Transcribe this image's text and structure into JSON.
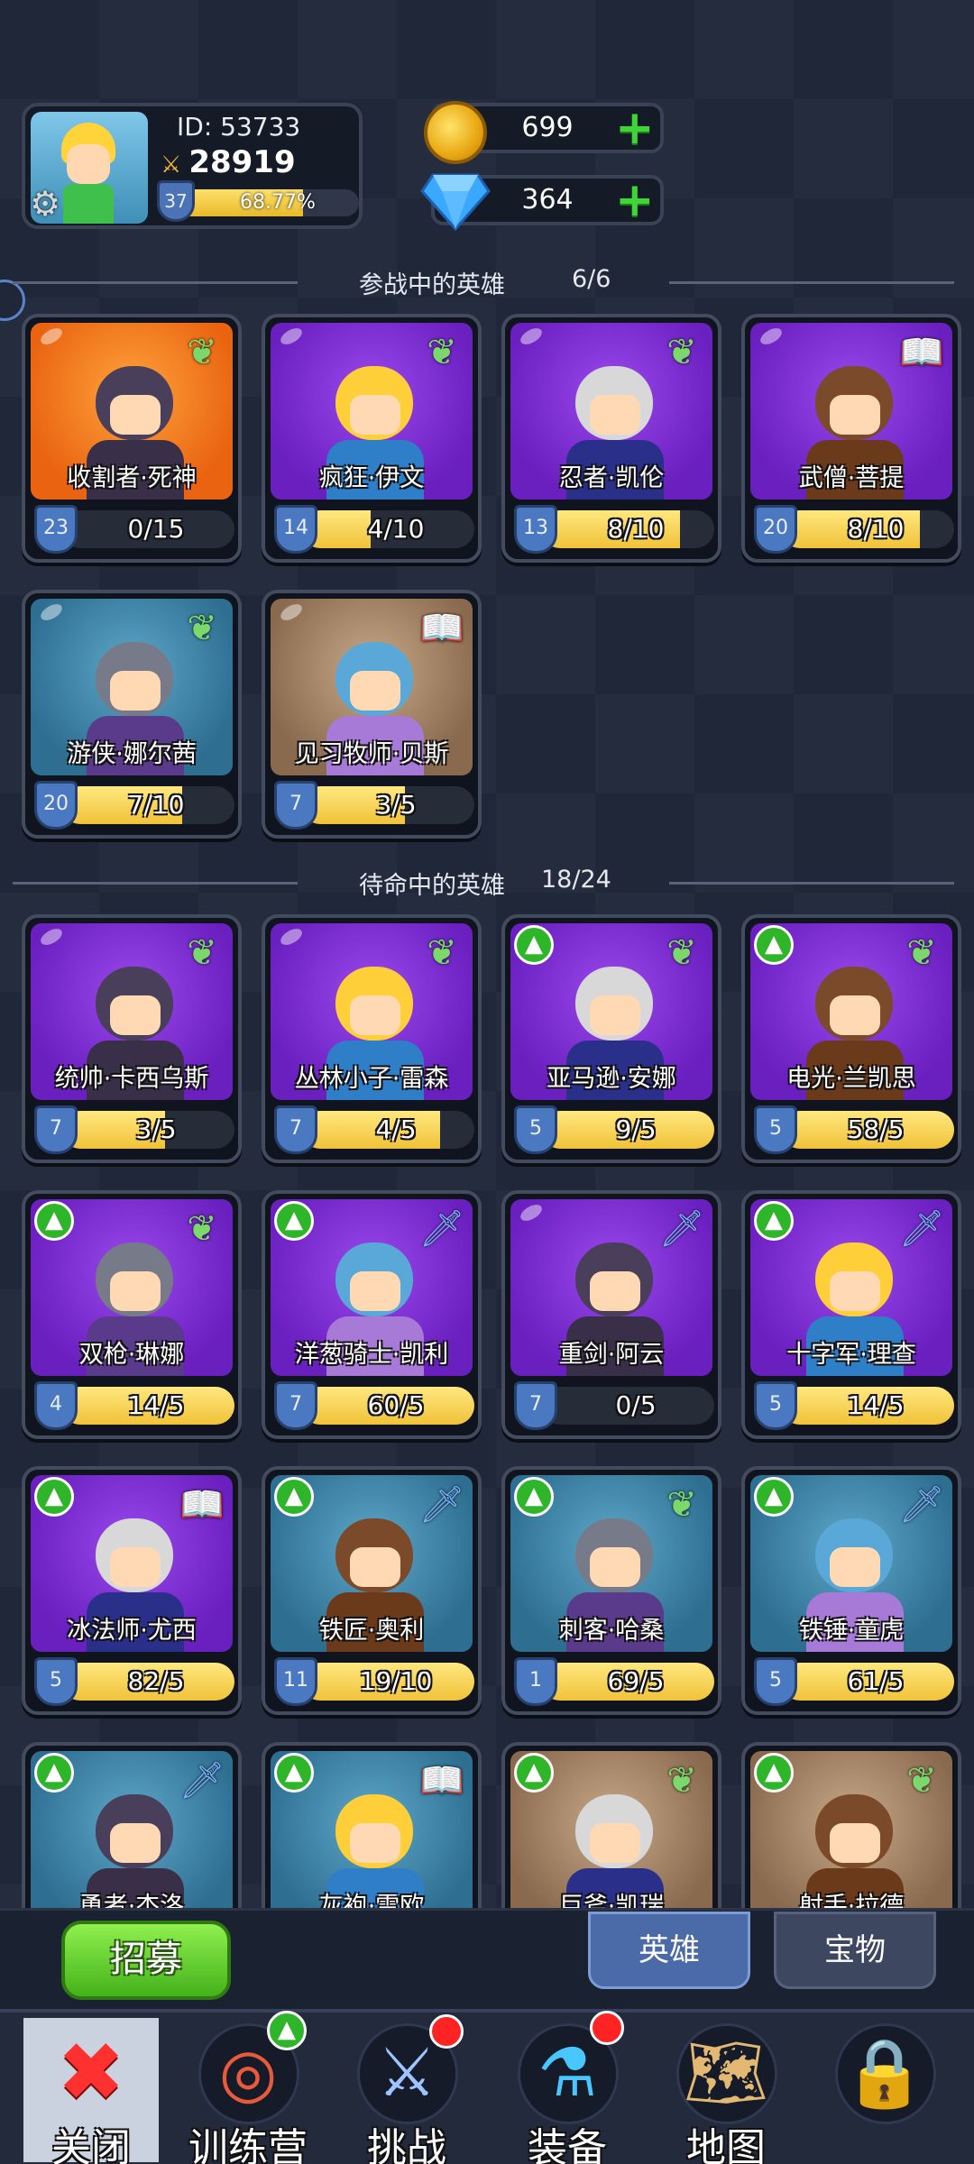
{
  "player": {
    "id_text": "ID:  53733",
    "power": "28919",
    "level": "37",
    "exp_text": "68.77%",
    "exp_fraction": 0.6877
  },
  "currency": {
    "gold": "699",
    "gems": "364"
  },
  "sections": {
    "active_title": "参战中的英雄",
    "active_count": "6/6",
    "standby_title": "待命中的英雄",
    "standby_count": "18/24"
  },
  "active_heroes": [
    {
      "name": "收割者·死神",
      "stars": "23",
      "progress": "0/15",
      "fill": 0.0,
      "bg": "orange",
      "class_icon": "wing-icon",
      "upgrade": false
    },
    {
      "name": "疯狂·伊文",
      "stars": "14",
      "progress": "4/10",
      "fill": 0.4,
      "bg": "purple",
      "class_icon": "wing-icon",
      "upgrade": false
    },
    {
      "name": "忍者·凯伦",
      "stars": "13",
      "progress": "8/10",
      "fill": 0.8,
      "bg": "purple",
      "class_icon": "wing-icon",
      "upgrade": false
    },
    {
      "name": "武僧·菩提",
      "stars": "20",
      "progress": "8/10",
      "fill": 0.8,
      "bg": "purple",
      "class_icon": "book-icon",
      "upgrade": false
    },
    {
      "name": "游侠·娜尔茜",
      "stars": "20",
      "progress": "7/10",
      "fill": 0.7,
      "bg": "blue",
      "class_icon": "wing-icon",
      "upgrade": false
    },
    {
      "name": "见习牧师·贝斯",
      "stars": "7",
      "progress": "3/5",
      "fill": 0.6,
      "bg": "brown",
      "class_icon": "book-icon",
      "upgrade": false
    }
  ],
  "standby_heroes": [
    {
      "name": "统帅·卡西乌斯",
      "stars": "7",
      "progress": "3/5",
      "fill": 0.6,
      "bg": "purple",
      "class_icon": "wing-icon",
      "upgrade": false
    },
    {
      "name": "丛林小子·雷森",
      "stars": "7",
      "progress": "4/5",
      "fill": 0.8,
      "bg": "purple",
      "class_icon": "wing-icon",
      "upgrade": false
    },
    {
      "name": "亚马逊·安娜",
      "stars": "5",
      "progress": "9/5",
      "fill": 1.0,
      "bg": "purple",
      "class_icon": "wing-icon",
      "upgrade": true
    },
    {
      "name": "电光·兰凯思",
      "stars": "5",
      "progress": "58/5",
      "fill": 1.0,
      "bg": "purple",
      "class_icon": "wing-icon",
      "upgrade": true
    },
    {
      "name": "双枪·琳娜",
      "stars": "4",
      "progress": "14/5",
      "fill": 1.0,
      "bg": "purple",
      "class_icon": "wing-icon",
      "upgrade": true
    },
    {
      "name": "洋葱骑士·凯利",
      "stars": "7",
      "progress": "60/5",
      "fill": 1.0,
      "bg": "purple",
      "class_icon": "dagger-icon",
      "upgrade": true
    },
    {
      "name": "重剑·阿云",
      "stars": "7",
      "progress": "0/5",
      "fill": 0.0,
      "bg": "purple",
      "class_icon": "dagger-icon",
      "upgrade": false
    },
    {
      "name": "十字军·理查",
      "stars": "5",
      "progress": "14/5",
      "fill": 1.0,
      "bg": "purple",
      "class_icon": "dagger-icon",
      "upgrade": true
    },
    {
      "name": "冰法师·尤西",
      "stars": "5",
      "progress": "82/5",
      "fill": 1.0,
      "bg": "purple",
      "class_icon": "book-icon",
      "upgrade": true
    },
    {
      "name": "铁匠·奥利",
      "stars": "11",
      "progress": "19/10",
      "fill": 1.0,
      "bg": "blue",
      "class_icon": "dagger-icon",
      "upgrade": true
    },
    {
      "name": "刺客·哈桑",
      "stars": "1",
      "progress": "69/5",
      "fill": 1.0,
      "bg": "blue",
      "class_icon": "wing-icon",
      "upgrade": true
    },
    {
      "name": "铁锤·童虎",
      "stars": "5",
      "progress": "61/5",
      "fill": 1.0,
      "bg": "blue",
      "class_icon": "dagger-icon",
      "upgrade": true
    },
    {
      "name": "勇者·杰洛",
      "stars": "",
      "progress": "",
      "fill": 0.0,
      "bg": "blue",
      "class_icon": "dagger-icon",
      "upgrade": true
    },
    {
      "name": "灰袍·雷欧",
      "stars": "",
      "progress": "",
      "fill": 0.0,
      "bg": "blue",
      "class_icon": "book-icon",
      "upgrade": true
    },
    {
      "name": "巨斧·凯瑞",
      "stars": "",
      "progress": "",
      "fill": 0.0,
      "bg": "brown",
      "class_icon": "wing-icon",
      "upgrade": true
    },
    {
      "name": "射手·拉德",
      "stars": "",
      "progress": "",
      "fill": 0.0,
      "bg": "brown",
      "class_icon": "wing-icon",
      "upgrade": true
    }
  ],
  "bottom": {
    "recruit": "招募",
    "tab_heroes": "英雄",
    "tab_treasure": "宝物"
  },
  "navbar": [
    {
      "label": "关闭",
      "icon": "close-icon",
      "badge": "none"
    },
    {
      "label": "训练营",
      "icon": "target-icon",
      "badge": "upgrade"
    },
    {
      "label": "挑战",
      "icon": "sword-icon",
      "badge": "red-dot"
    },
    {
      "label": "装备",
      "icon": "potion-icon",
      "badge": "red-dot"
    },
    {
      "label": "地图",
      "icon": "map-icon",
      "badge": "none"
    },
    {
      "label": "",
      "icon": "lock-icon",
      "badge": "none"
    }
  ]
}
